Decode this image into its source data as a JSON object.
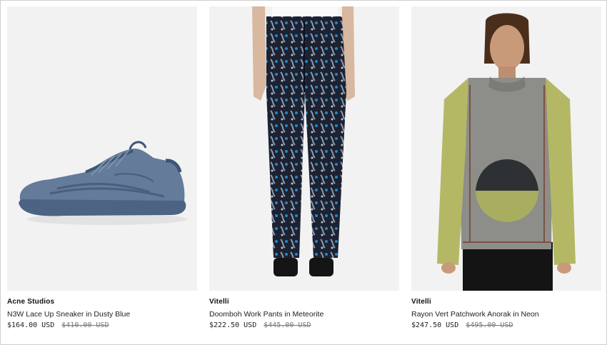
{
  "products": [
    {
      "brand": "Acne Studios",
      "name": "N3W Lace Up Sneaker in Dusty Blue",
      "price": "$164.00 USD",
      "was_price": "$410.00 USD",
      "image_icon": "sneaker-image",
      "accent": "#5c7491"
    },
    {
      "brand": "Vitelli",
      "name": "Doomboh Work Pants in Meteorite",
      "price": "$222.50 USD",
      "was_price": "$445.00 USD",
      "image_icon": "pants-image",
      "accent": "#2b3f6a"
    },
    {
      "brand": "Vitelli",
      "name": "Rayon Vert Patchwork Anorak in Neon",
      "price": "$247.50 USD",
      "was_price": "$495.00 USD",
      "image_icon": "sweater-image",
      "accent": "#b8bb6a"
    }
  ]
}
